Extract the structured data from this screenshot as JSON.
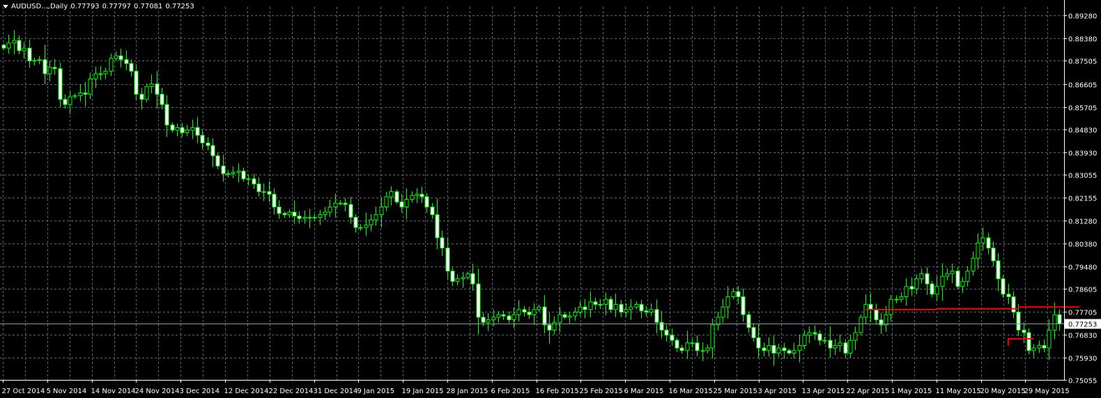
{
  "header": {
    "symbol": "AUDUSD...,Daily",
    "ohlc": [
      "0.77793",
      "0.77797",
      "0.77081",
      "0.77253"
    ]
  },
  "colors": {
    "background": "#000000",
    "grid": "#5a6a78",
    "axis": "#ffffff",
    "bull": "#00ff00",
    "bear": "#00ff00",
    "bull_body": "#000000",
    "bear_body": "#ffffff",
    "bid_line": "#8c9aa8",
    "hline": "#ff0000"
  },
  "chart_data": {
    "type": "candlestick",
    "symbol": "AUDUSD",
    "timeframe": "Daily",
    "ylim": [
      0.75055,
      0.8928
    ],
    "y_ticks": [
      "0.89280",
      "0.88380",
      "0.87505",
      "0.86605",
      "0.85705",
      "0.84830",
      "0.83930",
      "0.83055",
      "0.82155",
      "0.81280",
      "0.80380",
      "0.79480",
      "0.78605",
      "0.77705",
      "0.76830",
      "0.75930",
      "0.75055"
    ],
    "x_ticks": [
      "27 Oct 2014",
      "5 Nov 2014",
      "14 Nov 2014",
      "24 Nov 2014",
      "3 Dec 2014",
      "12 Dec 2014",
      "22 Dec 2014",
      "31 Dec 2014",
      "9 Jan 2015",
      "19 Jan 2015",
      "28 Jan 2015",
      "6 Feb 2015",
      "16 Feb 2015",
      "25 Feb 2015",
      "6 Mar 2015",
      "16 Mar 2015",
      "25 Mar 2015",
      "3 Apr 2015",
      "13 Apr 2015",
      "22 Apr 2015",
      "1 May 2015",
      "11 May 2015",
      "20 May 2015",
      "29 May 2015"
    ],
    "current_price": "0.77253",
    "horizontal_lines": [
      {
        "from_bar": 169,
        "to_bar": 183,
        "y": 0.778
      },
      {
        "from_bar": 183,
        "to_bar": 199,
        "y": 0.7783
      },
      {
        "from_bar": 199,
        "to_bar": 211,
        "y": 0.779
      },
      {
        "from_bar": 197,
        "to_bar": 202,
        "y": 0.7666
      }
    ],
    "closes": [
      0.88,
      0.882,
      0.883,
      0.879,
      0.88,
      0.875,
      0.8752,
      0.8755,
      0.87,
      0.8725,
      0.872,
      0.86,
      0.858,
      0.861,
      0.8615,
      0.8625,
      0.862,
      0.868,
      0.87,
      0.87,
      0.871,
      0.876,
      0.877,
      0.8755,
      0.874,
      0.871,
      0.862,
      0.86,
      0.865,
      0.866,
      0.862,
      0.858,
      0.85,
      0.848,
      0.849,
      0.847,
      0.848,
      0.849,
      0.846,
      0.843,
      0.842,
      0.838,
      0.834,
      0.831,
      0.831,
      0.8315,
      0.832,
      0.829,
      0.829,
      0.827,
      0.824,
      0.824,
      0.823,
      0.818,
      0.8155,
      0.815,
      0.816,
      0.8145,
      0.8135,
      0.814,
      0.814,
      0.814,
      0.815,
      0.816,
      0.818,
      0.8195,
      0.8195,
      0.819,
      0.814,
      0.81,
      0.81,
      0.811,
      0.813,
      0.815,
      0.818,
      0.822,
      0.824,
      0.82,
      0.818,
      0.821,
      0.8225,
      0.823,
      0.822,
      0.818,
      0.815,
      0.806,
      0.802,
      0.793,
      0.789,
      0.79,
      0.7905,
      0.792,
      0.788,
      0.775,
      0.773,
      0.774,
      0.775,
      0.776,
      0.7755,
      0.774,
      0.776,
      0.778,
      0.777,
      0.776,
      0.778,
      0.779,
      0.772,
      0.77,
      0.773,
      0.776,
      0.775,
      0.7755,
      0.777,
      0.779,
      0.778,
      0.781,
      0.78,
      0.78,
      0.782,
      0.778,
      0.78,
      0.777,
      0.778,
      0.779,
      0.78,
      0.7775,
      0.777,
      0.778,
      0.773,
      0.77,
      0.768,
      0.766,
      0.763,
      0.762,
      0.765,
      0.765,
      0.762,
      0.762,
      0.763,
      0.772,
      0.775,
      0.779,
      0.783,
      0.785,
      0.783,
      0.776,
      0.771,
      0.767,
      0.763,
      0.762,
      0.764,
      0.761,
      0.763,
      0.762,
      0.761,
      0.762,
      0.764,
      0.768,
      0.769,
      0.7685,
      0.766,
      0.766,
      0.763,
      0.764,
      0.765,
      0.761,
      0.766,
      0.769,
      0.775,
      0.78,
      0.778,
      0.774,
      0.772,
      0.776,
      0.782,
      0.782,
      0.783,
      0.787,
      0.786,
      0.79,
      0.792,
      0.788,
      0.784,
      0.787,
      0.791,
      0.792,
      0.793,
      0.787,
      0.789,
      0.793,
      0.798,
      0.804,
      0.806,
      0.802,
      0.797,
      0.79,
      0.784,
      0.783,
      0.777,
      0.77,
      0.769,
      0.762,
      0.763,
      0.764,
      0.763,
      0.77,
      0.776,
      0.7725
    ]
  }
}
